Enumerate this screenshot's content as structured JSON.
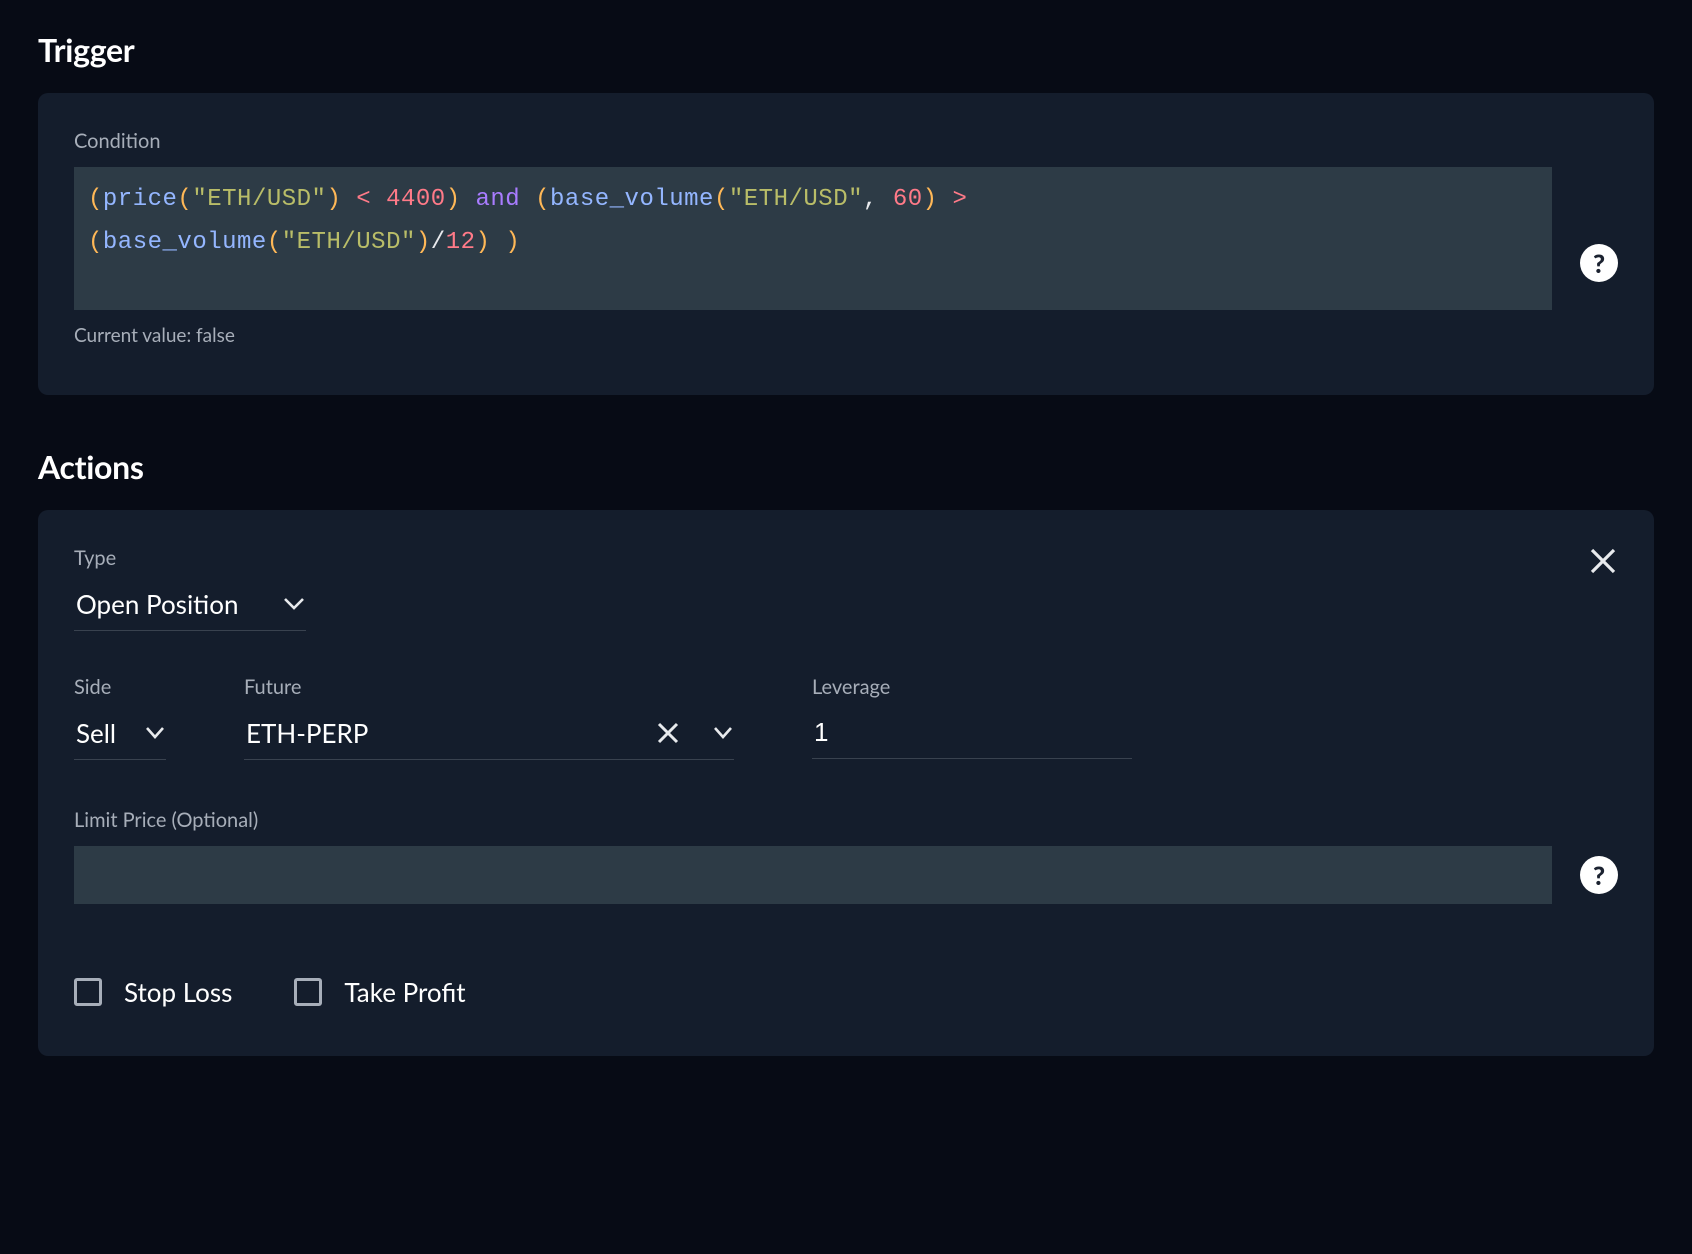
{
  "trigger": {
    "title": "Trigger",
    "condition_label": "Condition",
    "help_text": "?",
    "current_value": "Current value: false",
    "expression_tokens": [
      [
        "paren",
        "("
      ],
      [
        "fn",
        "price"
      ],
      [
        "paren",
        "("
      ],
      [
        "str",
        "\"ETH/USD\""
      ],
      [
        "paren",
        ")"
      ],
      [
        "sp",
        " "
      ],
      [
        "op",
        "<"
      ],
      [
        "sp",
        " "
      ],
      [
        "num",
        "4400"
      ],
      [
        "paren",
        ")"
      ],
      [
        "sp",
        " "
      ],
      [
        "kw",
        "and"
      ],
      [
        "sp",
        " "
      ],
      [
        "paren",
        "("
      ],
      [
        "fn",
        "base_volume"
      ],
      [
        "paren",
        "("
      ],
      [
        "str",
        "\"ETH/USD\""
      ],
      [
        "comma",
        ","
      ],
      [
        "sp",
        " "
      ],
      [
        "num",
        "60"
      ],
      [
        "paren",
        ")"
      ],
      [
        "sp",
        " "
      ],
      [
        "op",
        ">"
      ],
      [
        "sp",
        "\n"
      ],
      [
        "paren",
        "("
      ],
      [
        "fn",
        "base_volume"
      ],
      [
        "paren",
        "("
      ],
      [
        "str",
        "\"ETH/USD\""
      ],
      [
        "paren",
        ")"
      ],
      [
        "slash",
        "/"
      ],
      [
        "num",
        "12"
      ],
      [
        "paren",
        ")"
      ],
      [
        "sp",
        " "
      ],
      [
        "paren",
        ")"
      ]
    ]
  },
  "actions": {
    "title": "Actions",
    "type_label": "Type",
    "type_value": "Open Position",
    "side_label": "Side",
    "side_value": "Sell",
    "future_label": "Future",
    "future_value": "ETH-PERP",
    "leverage_label": "Leverage",
    "leverage_value": "1",
    "limit_label": "Limit Price (Optional)",
    "limit_value": "",
    "help_text": "?",
    "stop_loss_label": "Stop Loss",
    "take_profit_label": "Take Profit",
    "stop_loss_checked": false,
    "take_profit_checked": false
  }
}
